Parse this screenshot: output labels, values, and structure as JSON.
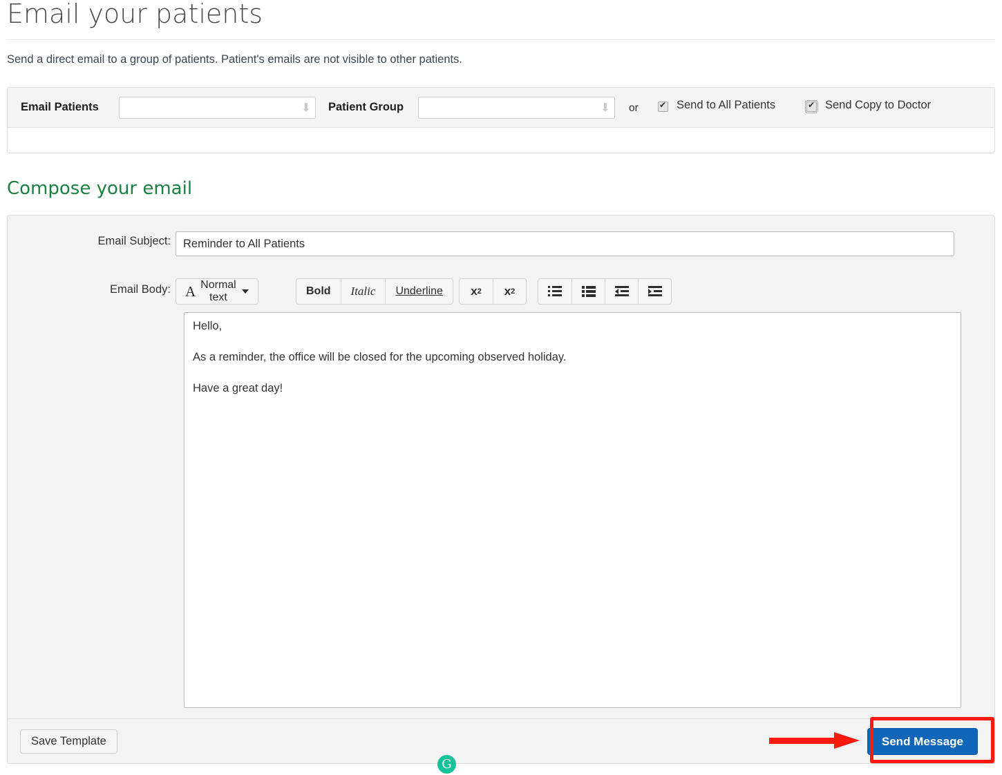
{
  "header": {
    "title": "Email your patients",
    "subtitle": "Send a direct email to a group of patients. Patient's emails are not visible to other patients."
  },
  "selector": {
    "email_patients_label": "Email Patients",
    "email_patients_value": "",
    "patient_group_label": "Patient Group",
    "patient_group_value": "",
    "or_text": "or",
    "send_all_label": "Send to All Patients",
    "send_copy_label": "Send Copy to Doctor",
    "dropdown_icon": "down-arrow-icon"
  },
  "compose": {
    "heading": "Compose your email",
    "heading_color": "#1b8141",
    "subject_label": "Email Subject:",
    "subject_value": "Reminder to All Patients",
    "body_label": "Email Body:",
    "toolbar": {
      "style_label": "Normal text",
      "style_icon": "serif-a-icon",
      "caret_icon": "caret-down-icon",
      "bold_label": "Bold",
      "italic_label": "Italic",
      "underline_label": "Underline",
      "subscript_label": "x2",
      "superscript_label": "x2",
      "numbered_list_icon": "numbered-list-icon",
      "bullet_list_icon": "bullet-list-icon",
      "outdent_icon": "outdent-icon",
      "indent_icon": "indent-icon"
    },
    "body_paragraphs": [
      "Hello,",
      "As a reminder, the office will be closed for the upcoming observed holiday.",
      "Have a great day!"
    ]
  },
  "footer": {
    "save_template_label": "Save Template",
    "send_message_label": "Send Message",
    "send_button_color": "#1266ba"
  },
  "annotations": {
    "highlight_color": "#fb1a0b",
    "arrow_name": "red-arrow-pointing-to-send-message"
  },
  "overlay": {
    "grammarly_glyph": "G"
  }
}
